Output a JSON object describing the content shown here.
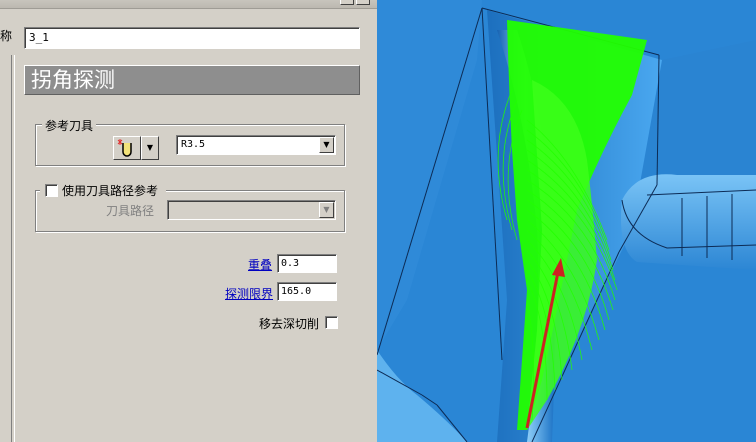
{
  "title_bar": {
    "help_label": "?",
    "close_label": "✕"
  },
  "form": {
    "name_label": "称",
    "name_value": "3_1",
    "header": "拐角探测",
    "reference_tool": {
      "legend": "参考刀具",
      "tool_icon": "ball-nose-tool-icon",
      "tool_value": "R3.5"
    },
    "toolpath_reference": {
      "checkbox_label": "使用刀具路径参考",
      "checked": false,
      "toolpath_label": "刀具路径",
      "toolpath_value": ""
    },
    "overlap_label": "重叠",
    "overlap_value": "0.3",
    "detection_limit_label": "探测限界",
    "detection_limit_value": "165.0",
    "remove_gouge_label": "移去深切削",
    "remove_gouge_checked": false
  },
  "viewport": {
    "background_color": "#2a86d5",
    "toolpath_color": "#22ff00",
    "arrow_color": "#cc2222"
  }
}
